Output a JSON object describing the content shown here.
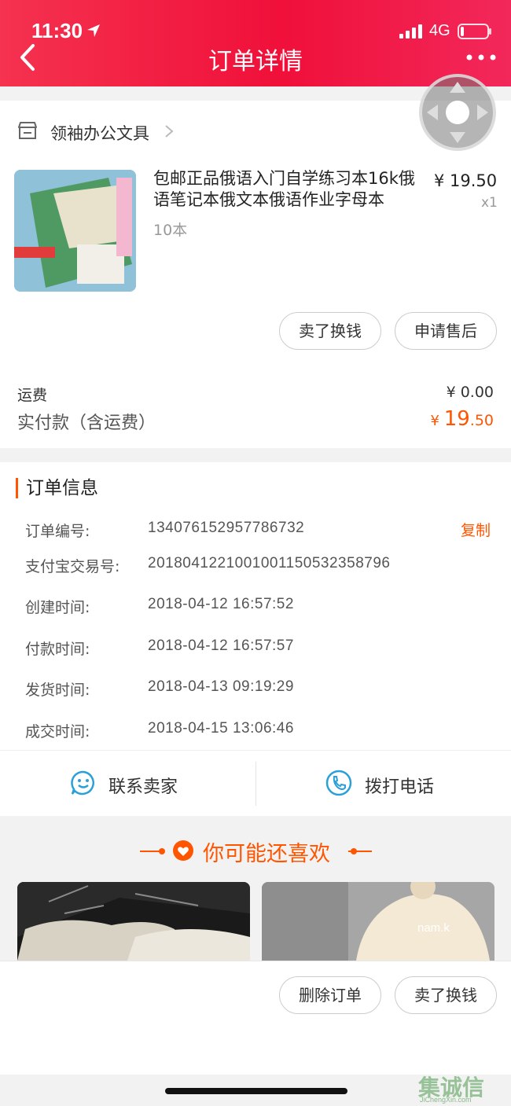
{
  "status_bar": {
    "time": "11:30",
    "network": "4G"
  },
  "header": {
    "title": "订单详情"
  },
  "shop": {
    "name": "领袖办公文具"
  },
  "product": {
    "title": "包邮正品俄语入门自学练习本16k俄语笔记本俄文本俄语作业字母本",
    "sku": "10本",
    "price": "¥ 19.50",
    "quantity": "x1"
  },
  "item_actions": {
    "sell_label": "卖了换钱",
    "after_sale_label": "申请售后"
  },
  "fees": {
    "shipping_label": "运费",
    "shipping_value": "¥ 0.00",
    "paid_label": "实付款（含运费）",
    "paid_currency": "¥ ",
    "paid_integer": "19",
    "paid_decimal": ".50"
  },
  "order_info": {
    "title": "订单信息",
    "copy_label": "复制",
    "rows": [
      {
        "label": "订单编号:",
        "value": "134076152957786732"
      },
      {
        "label": "支付宝交易号:",
        "value": "2018041221001001150532358796"
      },
      {
        "label": "创建时间:",
        "value": "2018-04-12 16:57:52"
      },
      {
        "label": "付款时间:",
        "value": "2018-04-12 16:57:57"
      },
      {
        "label": "发货时间:",
        "value": "2018-04-13 09:19:29"
      },
      {
        "label": "成交时间:",
        "value": "2018-04-15 13:06:46"
      }
    ]
  },
  "contact": {
    "seller_label": "联系卖家",
    "phone_label": "拨打电话"
  },
  "recommend": {
    "title": "你可能还喜欢",
    "item2_text": "nam.k"
  },
  "bottom_actions": {
    "delete_label": "删除订单",
    "sell_label": "卖了换钱"
  },
  "watermark": {
    "text": "集诚信",
    "sub": "JiChengXin.com"
  },
  "colors": {
    "brand_red": "#f0103a",
    "accent_orange": "#ff5500"
  }
}
